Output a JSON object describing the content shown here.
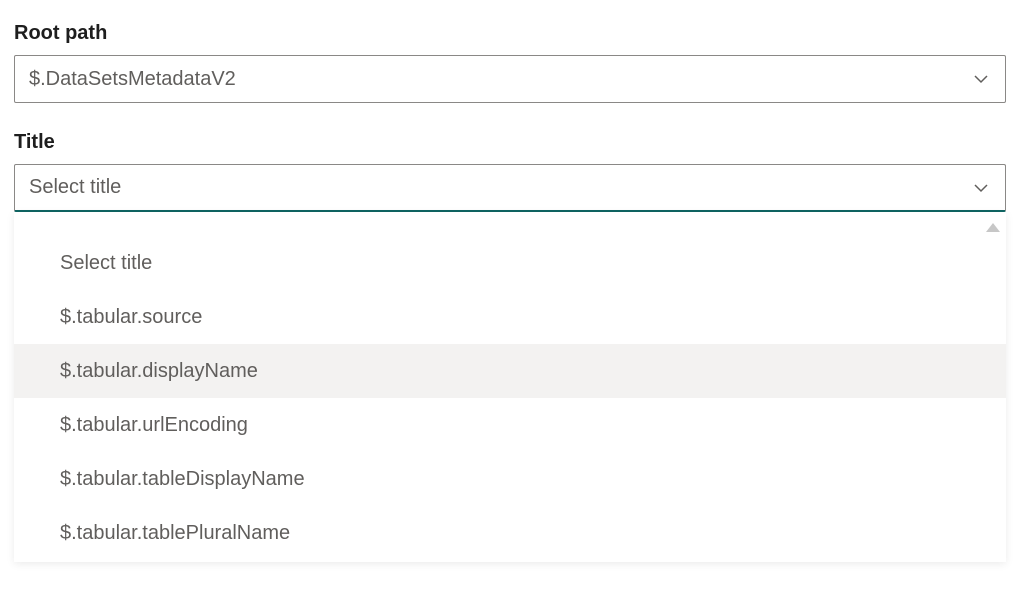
{
  "rootPath": {
    "label": "Root path",
    "value": "$.DataSetsMetadataV2"
  },
  "title": {
    "label": "Title",
    "placeholder": "Select title",
    "options": [
      "Select title",
      "$.tabular.source",
      "$.tabular.displayName",
      "$.tabular.urlEncoding",
      "$.tabular.tableDisplayName",
      "$.tabular.tablePluralName"
    ],
    "hoverIndex": 2
  }
}
